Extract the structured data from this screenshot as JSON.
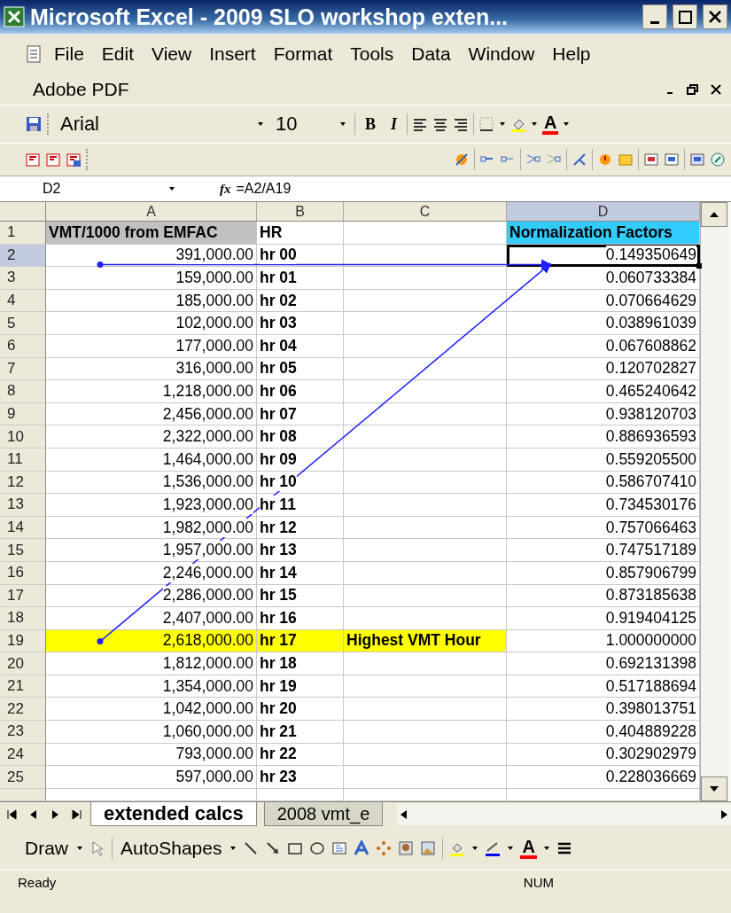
{
  "window": {
    "title": "Microsoft Excel - 2009 SLO workshop exten..."
  },
  "menu": [
    {
      "label": "File"
    },
    {
      "label": "Edit"
    },
    {
      "label": "View"
    },
    {
      "label": "Insert"
    },
    {
      "label": "Format"
    },
    {
      "label": "Tools"
    },
    {
      "label": "Data"
    },
    {
      "label": "Window"
    },
    {
      "label": "Help"
    },
    {
      "label": "Adobe PDF"
    }
  ],
  "formatting_toolbar": {
    "font": "Arial",
    "size": "10",
    "bold_button": "B",
    "italic_button": "I",
    "font_color_button": "A"
  },
  "formula_bar": {
    "name_box": "D2",
    "fx": "fx",
    "formula": "=A2/A19"
  },
  "columns": [
    "A",
    "B",
    "C",
    "D"
  ],
  "rows": [
    {
      "header": "1",
      "cells": [
        {
          "text": "VMT/1000 from EMFAC",
          "bold": true,
          "selected": false,
          "color": "#c0c0c0"
        },
        {
          "text": "HR",
          "bold": true,
          "selected": false
        },
        {
          "selected": false
        },
        {
          "text": "Normalization Factors",
          "bold": true,
          "selected": false,
          "color": "#33ccff"
        }
      ]
    },
    {
      "header": "2",
      "cells": [
        {
          "text": "391,000.00",
          "bold": false,
          "selected": false
        },
        {
          "text": "hr 00",
          "bold": true,
          "selected": false
        },
        {
          "selected": false
        },
        {
          "text": "0.149350649",
          "bold": false,
          "selected": true
        }
      ]
    },
    {
      "header": "3",
      "cells": [
        {
          "text": "159,000.00",
          "bold": false,
          "selected": false
        },
        {
          "text": "hr 01",
          "bold": true,
          "selected": false
        },
        {
          "selected": false
        },
        {
          "text": "0.060733384",
          "bold": false,
          "selected": false
        }
      ]
    },
    {
      "header": "4",
      "cells": [
        {
          "text": "185,000.00",
          "bold": false,
          "selected": false
        },
        {
          "text": "hr 02",
          "bold": true,
          "selected": false
        },
        {
          "selected": false
        },
        {
          "text": "0.070664629",
          "bold": false,
          "selected": false
        }
      ]
    },
    {
      "header": "5",
      "cells": [
        {
          "text": "102,000.00",
          "bold": false,
          "selected": false
        },
        {
          "text": "hr 03",
          "bold": true,
          "selected": false
        },
        {
          "selected": false
        },
        {
          "text": "0.038961039",
          "bold": false,
          "selected": false
        }
      ]
    },
    {
      "header": "6",
      "cells": [
        {
          "text": "177,000.00",
          "bold": false,
          "selected": false
        },
        {
          "text": "hr 04",
          "bold": true,
          "selected": false
        },
        {
          "selected": false
        },
        {
          "text": "0.067608862",
          "bold": false,
          "selected": false
        }
      ]
    },
    {
      "header": "7",
      "cells": [
        {
          "text": "316,000.00",
          "bold": false,
          "selected": false
        },
        {
          "text": "hr 05",
          "bold": true,
          "selected": false
        },
        {
          "selected": false
        },
        {
          "text": "0.120702827",
          "bold": false,
          "selected": false
        }
      ]
    },
    {
      "header": "8",
      "cells": [
        {
          "text": "1,218,000.00",
          "bold": false,
          "selected": false
        },
        {
          "text": "hr 06",
          "bold": true,
          "selected": false
        },
        {
          "selected": false
        },
        {
          "text": "0.465240642",
          "bold": false,
          "selected": false
        }
      ]
    },
    {
      "header": "9",
      "cells": [
        {
          "text": "2,456,000.00",
          "bold": false,
          "selected": false
        },
        {
          "text": "hr 07",
          "bold": true,
          "selected": false
        },
        {
          "selected": false
        },
        {
          "text": "0.938120703",
          "bold": false,
          "selected": false
        }
      ]
    },
    {
      "header": "10",
      "cells": [
        {
          "text": "2,322,000.00",
          "bold": false,
          "selected": false
        },
        {
          "text": "hr 08",
          "bold": true,
          "selected": false
        },
        {
          "selected": false
        },
        {
          "text": "0.886936593",
          "bold": false,
          "selected": false
        }
      ]
    },
    {
      "header": "11",
      "cells": [
        {
          "text": "1,464,000.00",
          "bold": false,
          "selected": false
        },
        {
          "text": "hr 09",
          "bold": true,
          "selected": false
        },
        {
          "selected": false
        },
        {
          "text": "0.559205500",
          "bold": false,
          "selected": false
        }
      ]
    },
    {
      "header": "12",
      "cells": [
        {
          "text": "1,536,000.00",
          "bold": false,
          "selected": false
        },
        {
          "text": "hr 10",
          "bold": true,
          "selected": false
        },
        {
          "selected": false
        },
        {
          "text": "0.586707410",
          "bold": false,
          "selected": false
        }
      ]
    },
    {
      "header": "13",
      "cells": [
        {
          "text": "1,923,000.00",
          "bold": false,
          "selected": false
        },
        {
          "text": "hr 11",
          "bold": true,
          "selected": false
        },
        {
          "selected": false
        },
        {
          "text": "0.734530176",
          "bold": false,
          "selected": false
        }
      ]
    },
    {
      "header": "14",
      "cells": [
        {
          "text": "1,982,000.00",
          "bold": false,
          "selected": false
        },
        {
          "text": "hr 12",
          "bold": true,
          "selected": false
        },
        {
          "selected": false
        },
        {
          "text": "0.757066463",
          "bold": false,
          "selected": false
        }
      ]
    },
    {
      "header": "15",
      "cells": [
        {
          "text": "1,957,000.00",
          "bold": false,
          "selected": false
        },
        {
          "text": "hr 13",
          "bold": true,
          "selected": false
        },
        {
          "selected": false
        },
        {
          "text": "0.747517189",
          "bold": false,
          "selected": false
        }
      ]
    },
    {
      "header": "16",
      "cells": [
        {
          "text": "2,246,000.00",
          "bold": false,
          "selected": false
        },
        {
          "text": "hr 14",
          "bold": true,
          "selected": false
        },
        {
          "selected": false
        },
        {
          "text": "0.857906799",
          "bold": false,
          "selected": false
        }
      ]
    },
    {
      "header": "17",
      "cells": [
        {
          "text": "2,286,000.00",
          "bold": false,
          "selected": false
        },
        {
          "text": "hr 15",
          "bold": true,
          "selected": false
        },
        {
          "selected": false
        },
        {
          "text": "0.873185638",
          "bold": false,
          "selected": false
        }
      ]
    },
    {
      "header": "18",
      "cells": [
        {
          "text": "2,407,000.00",
          "bold": false,
          "selected": false
        },
        {
          "text": "hr 16",
          "bold": true,
          "selected": false
        },
        {
          "selected": false
        },
        {
          "text": "0.919404125",
          "bold": false,
          "selected": false
        }
      ]
    },
    {
      "header": "19",
      "cells": [
        {
          "text": "2,618,000.00",
          "bold": false,
          "selected": false,
          "color": "#ffff00"
        },
        {
          "text": "hr 17",
          "bold": true,
          "selected": false,
          "color": "#ffff00"
        },
        {
          "text": "Highest VMT Hour",
          "bold": true,
          "selected": false,
          "color": "#ffff00"
        },
        {
          "text": "1.000000000",
          "bold": false,
          "selected": false
        }
      ]
    },
    {
      "header": "20",
      "cells": [
        {
          "text": "1,812,000.00",
          "bold": false,
          "selected": false
        },
        {
          "text": "hr 18",
          "bold": true,
          "selected": false
        },
        {
          "selected": false
        },
        {
          "text": "0.692131398",
          "bold": false,
          "selected": false
        }
      ]
    },
    {
      "header": "21",
      "cells": [
        {
          "text": "1,354,000.00",
          "bold": false,
          "selected": false
        },
        {
          "text": "hr 19",
          "bold": true,
          "selected": false
        },
        {
          "selected": false
        },
        {
          "text": "0.517188694",
          "bold": false,
          "selected": false
        }
      ]
    },
    {
      "header": "22",
      "cells": [
        {
          "text": "1,042,000.00",
          "bold": false,
          "selected": false
        },
        {
          "text": "hr 20",
          "bold": true,
          "selected": false
        },
        {
          "selected": false
        },
        {
          "text": "0.398013751",
          "bold": false,
          "selected": false
        }
      ]
    },
    {
      "header": "23",
      "cells": [
        {
          "text": "1,060,000.00",
          "bold": false,
          "selected": false
        },
        {
          "text": "hr 21",
          "bold": true,
          "selected": false
        },
        {
          "selected": false
        },
        {
          "text": "0.404889228",
          "bold": false,
          "selected": false
        }
      ]
    },
    {
      "header": "24",
      "cells": [
        {
          "text": "793,000.00",
          "bold": false,
          "selected": false
        },
        {
          "text": "hr 22",
          "bold": true,
          "selected": false
        },
        {
          "selected": false
        },
        {
          "text": "0.302902979",
          "bold": false,
          "selected": false
        }
      ]
    },
    {
      "header": "25",
      "cells": [
        {
          "text": "597,000.00",
          "bold": false,
          "selected": false
        },
        {
          "text": "hr 23",
          "bold": true,
          "selected": false
        },
        {
          "selected": false
        },
        {
          "text": "0.228036669",
          "bold": false,
          "selected": false
        }
      ]
    }
  ],
  "sheet_tabs": [
    {
      "label": "extended calcs",
      "selected": true
    },
    {
      "label": "2008 vmt_e",
      "selected": false
    }
  ],
  "drawing_toolbar": [
    {
      "label": "Draw"
    },
    {
      "label": "AutoShapes"
    }
  ],
  "drawing_font_color_button": "A",
  "status_bar": {
    "left": "Ready",
    "right": "NUM"
  }
}
